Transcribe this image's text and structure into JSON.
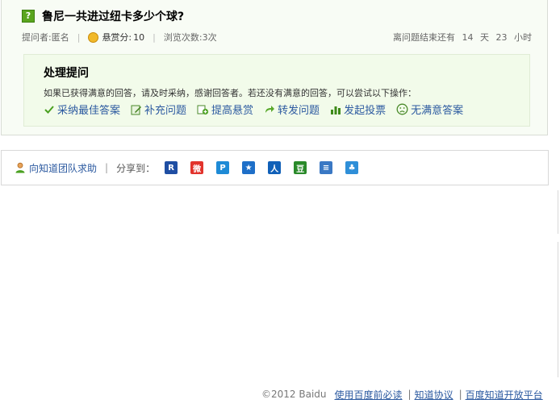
{
  "question": {
    "title": "鲁尼一共进过纽卡多少个球?",
    "asker_label": "提问者:",
    "asker_name": "匿名",
    "reward_label": "悬赏分:",
    "reward_value": "10",
    "views_label": "浏览次数:",
    "views_value": "3次",
    "time_prefix": "离问题结束还有",
    "days": "14",
    "days_unit": "天",
    "hours": "23",
    "hours_unit": "小时"
  },
  "handle": {
    "title": "处理提问",
    "description": "如果已获得满意的回答，请及时采纳，感谢回答者。若还没有满意的回答，可以尝试以下操作：",
    "actions": [
      {
        "label": "采纳最佳答案",
        "icon": "check-icon"
      },
      {
        "label": "补充问题",
        "icon": "edit-icon"
      },
      {
        "label": "提高悬赏",
        "icon": "reward-up-icon"
      },
      {
        "label": "转发问题",
        "icon": "forward-icon"
      },
      {
        "label": "发起投票",
        "icon": "vote-icon"
      },
      {
        "label": "无满意答案",
        "icon": "sad-face-icon"
      }
    ]
  },
  "share": {
    "help_label": "向知道团队求助",
    "share_label": "分享到：",
    "targets": [
      {
        "icon": "renren-share-icon",
        "color": "#1f4ea3",
        "glyph": "R"
      },
      {
        "icon": "weibo-share-icon",
        "color": "#e2332c",
        "glyph": "微"
      },
      {
        "icon": "qzone-share-icon",
        "color": "#1e8bd6",
        "glyph": "P"
      },
      {
        "icon": "qq-star-share-icon",
        "color": "#1e6fc8",
        "glyph": "★"
      },
      {
        "icon": "people-share-icon",
        "color": "#1060b8",
        "glyph": "人"
      },
      {
        "icon": "douban-share-icon",
        "color": "#2a8a2a",
        "glyph": "豆"
      },
      {
        "icon": "kaixin-share-icon",
        "color": "#3a78c4",
        "glyph": "≡"
      },
      {
        "icon": "pengyou-share-icon",
        "color": "#2f8fd8",
        "glyph": "♣"
      }
    ]
  },
  "footer": {
    "copyright": "©2012 Baidu",
    "links": [
      "使用百度前必读",
      "知道协议",
      "百度知道开放平台"
    ]
  },
  "colors": {
    "link": "#2c5aa0",
    "question_bg": "#f8fcf5",
    "handle_bg": "#f2fbea",
    "accent_green": "#5aa51e"
  }
}
